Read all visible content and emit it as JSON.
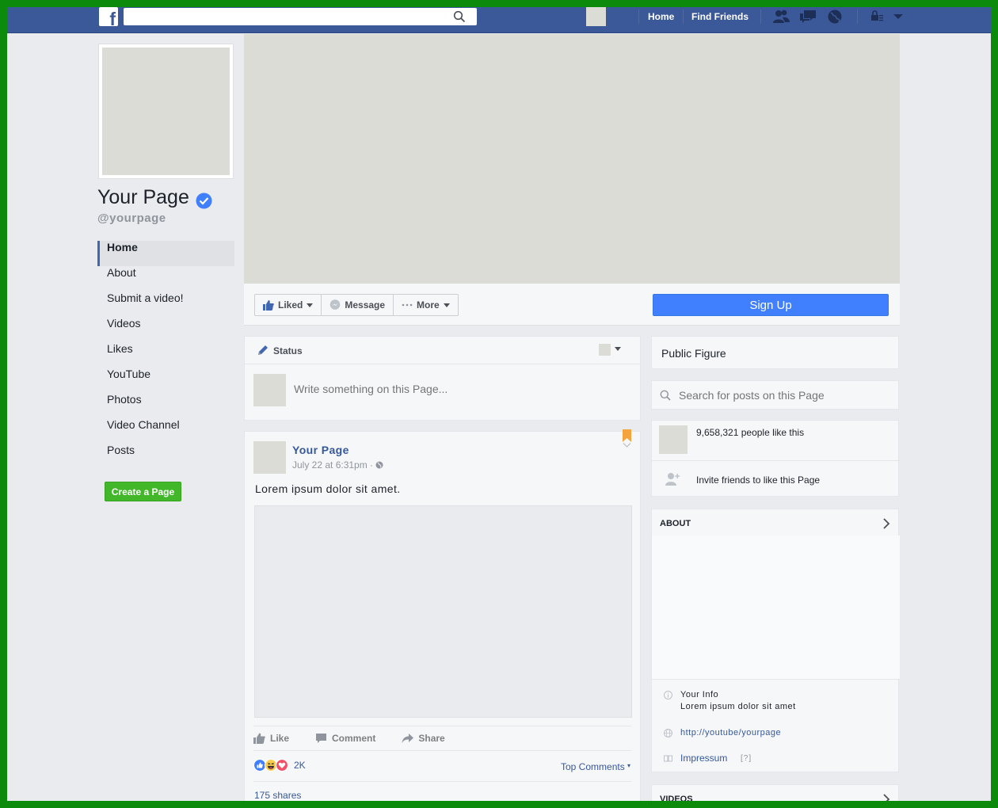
{
  "topbar": {
    "search_placeholder": "",
    "nav": [
      "Home",
      "Find Friends"
    ],
    "logo_letter": "f"
  },
  "profile": {
    "name": "Your Page",
    "handle": "@yourpage"
  },
  "sidebar": {
    "items": [
      {
        "label": "Home",
        "active": true
      },
      {
        "label": "About"
      },
      {
        "label": "Submit a video!"
      },
      {
        "label": "Videos"
      },
      {
        "label": "Likes"
      },
      {
        "label": "YouTube"
      },
      {
        "label": "Photos"
      },
      {
        "label": "Video Channel"
      },
      {
        "label": "Posts"
      }
    ],
    "create_page": "Create a Page"
  },
  "actions": {
    "liked": "Liked",
    "message": "Message",
    "more": "More",
    "signup": "Sign Up"
  },
  "composer": {
    "tab": "Status",
    "placeholder": "Write something on this Page..."
  },
  "post": {
    "author": "Your Page",
    "time": "July 22 at 6:31pm ·",
    "text": "Lorem ipsum dolor sit amet.",
    "like": "Like",
    "comment": "Comment",
    "share": "Share",
    "reaction_count": "2K",
    "top_comments": "Top Comments",
    "shares": "175 shares"
  },
  "right": {
    "category": "Public Figure",
    "search_placeholder": "Search for posts on this Page",
    "likes_text": "9,658,321 people like this",
    "invite_text": "Invite friends to like this Page",
    "about_heading": "ABOUT",
    "info_title": "Your Info",
    "info_body": "Lorem ipsum dolor sit amet",
    "link": "http://youtube/yourpage",
    "impressum": "Impressum",
    "impressum_help": "[?]",
    "videos_heading": "VIDEOS"
  },
  "colors": {
    "brand": "#3b5998",
    "signup": "#4080ff",
    "create": "#42b72a",
    "frame": "#0c8a0c",
    "placeholder": "#dcdcd6"
  }
}
